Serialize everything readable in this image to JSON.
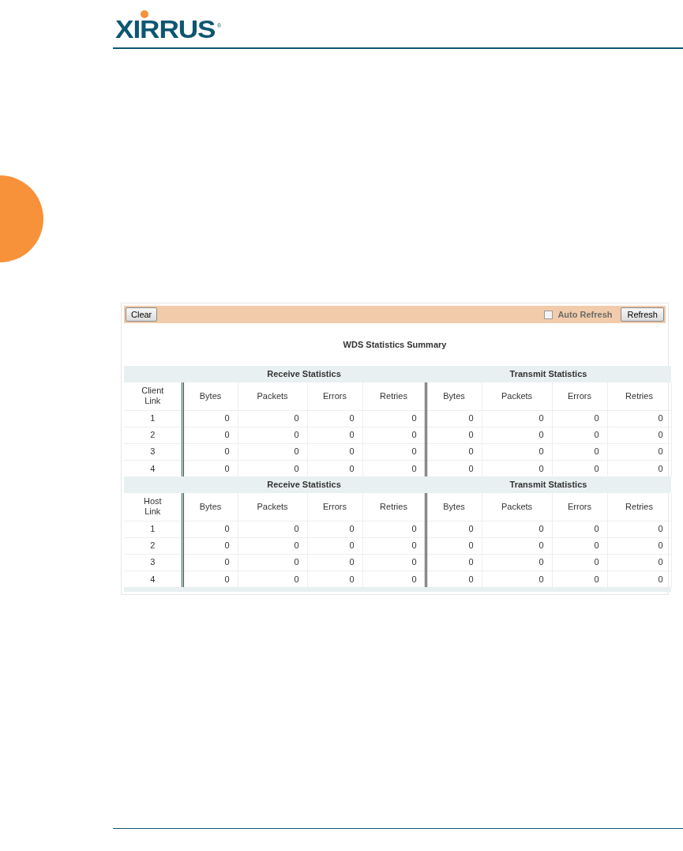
{
  "header": {
    "logo": "XIRRUS",
    "logo_mark": "®"
  },
  "toolbar": {
    "clear_button": "Clear",
    "auto_refresh": {
      "label": "Auto Refresh",
      "checked": false
    },
    "refresh_button": "Refresh"
  },
  "title": "WDS Statistics Summary",
  "sections": [
    {
      "groups": [
        "Receive Statistics",
        "Transmit Statistics"
      ],
      "columns": [
        "Client\nLink",
        "Bytes",
        "Packets",
        "Errors",
        "Retries",
        "Bytes",
        "Packets",
        "Errors",
        "Retries"
      ],
      "rows": [
        [
          "1",
          "0",
          "0",
          "0",
          "0",
          "0",
          "0",
          "0",
          "0"
        ],
        [
          "2",
          "0",
          "0",
          "0",
          "0",
          "0",
          "0",
          "0",
          "0"
        ],
        [
          "3",
          "0",
          "0",
          "0",
          "0",
          "0",
          "0",
          "0",
          "0"
        ],
        [
          "4",
          "0",
          "0",
          "0",
          "0",
          "0",
          "0",
          "0",
          "0"
        ]
      ]
    },
    {
      "groups": [
        "Receive Statistics",
        "Transmit Statistics"
      ],
      "columns": [
        "Host\nLink",
        "Bytes",
        "Packets",
        "Errors",
        "Retries",
        "Bytes",
        "Packets",
        "Errors",
        "Retries"
      ],
      "rows": [
        [
          "1",
          "0",
          "0",
          "0",
          "0",
          "0",
          "0",
          "0",
          "0"
        ],
        [
          "2",
          "0",
          "0",
          "0",
          "0",
          "0",
          "0",
          "0",
          "0"
        ],
        [
          "3",
          "0",
          "0",
          "0",
          "0",
          "0",
          "0",
          "0",
          "0"
        ],
        [
          "4",
          "0",
          "0",
          "0",
          "0",
          "0",
          "0",
          "0",
          "0"
        ]
      ]
    }
  ]
}
